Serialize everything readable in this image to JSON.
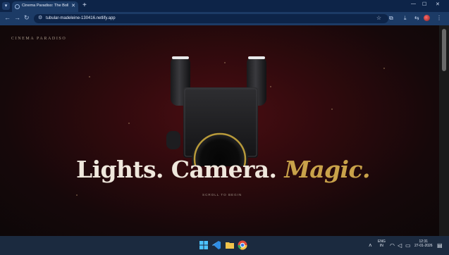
{
  "browser": {
    "tab_title": "Cinema Paradiso: The Bollywo...",
    "url": "tubular-madeleine-130416.netlify.app"
  },
  "page": {
    "brand": "CINEMA PARADISO",
    "headline_part1": "Lights. Camera.",
    "headline_part2": "Magic.",
    "scroll_hint": "SCROLL TO BEGIN"
  },
  "taskbar": {
    "language": "ENG",
    "region": "IN",
    "time": "12:31",
    "date": "27-01-2026"
  },
  "colors": {
    "accent_gold": "#c9a24a",
    "headline": "#efe7dc",
    "background": "#300a0d"
  },
  "icons": [
    "windows-start-icon",
    "vscode-icon",
    "file-explorer-icon",
    "chrome-icon",
    "wifi-icon",
    "volume-icon",
    "battery-icon",
    "notification-icon"
  ]
}
